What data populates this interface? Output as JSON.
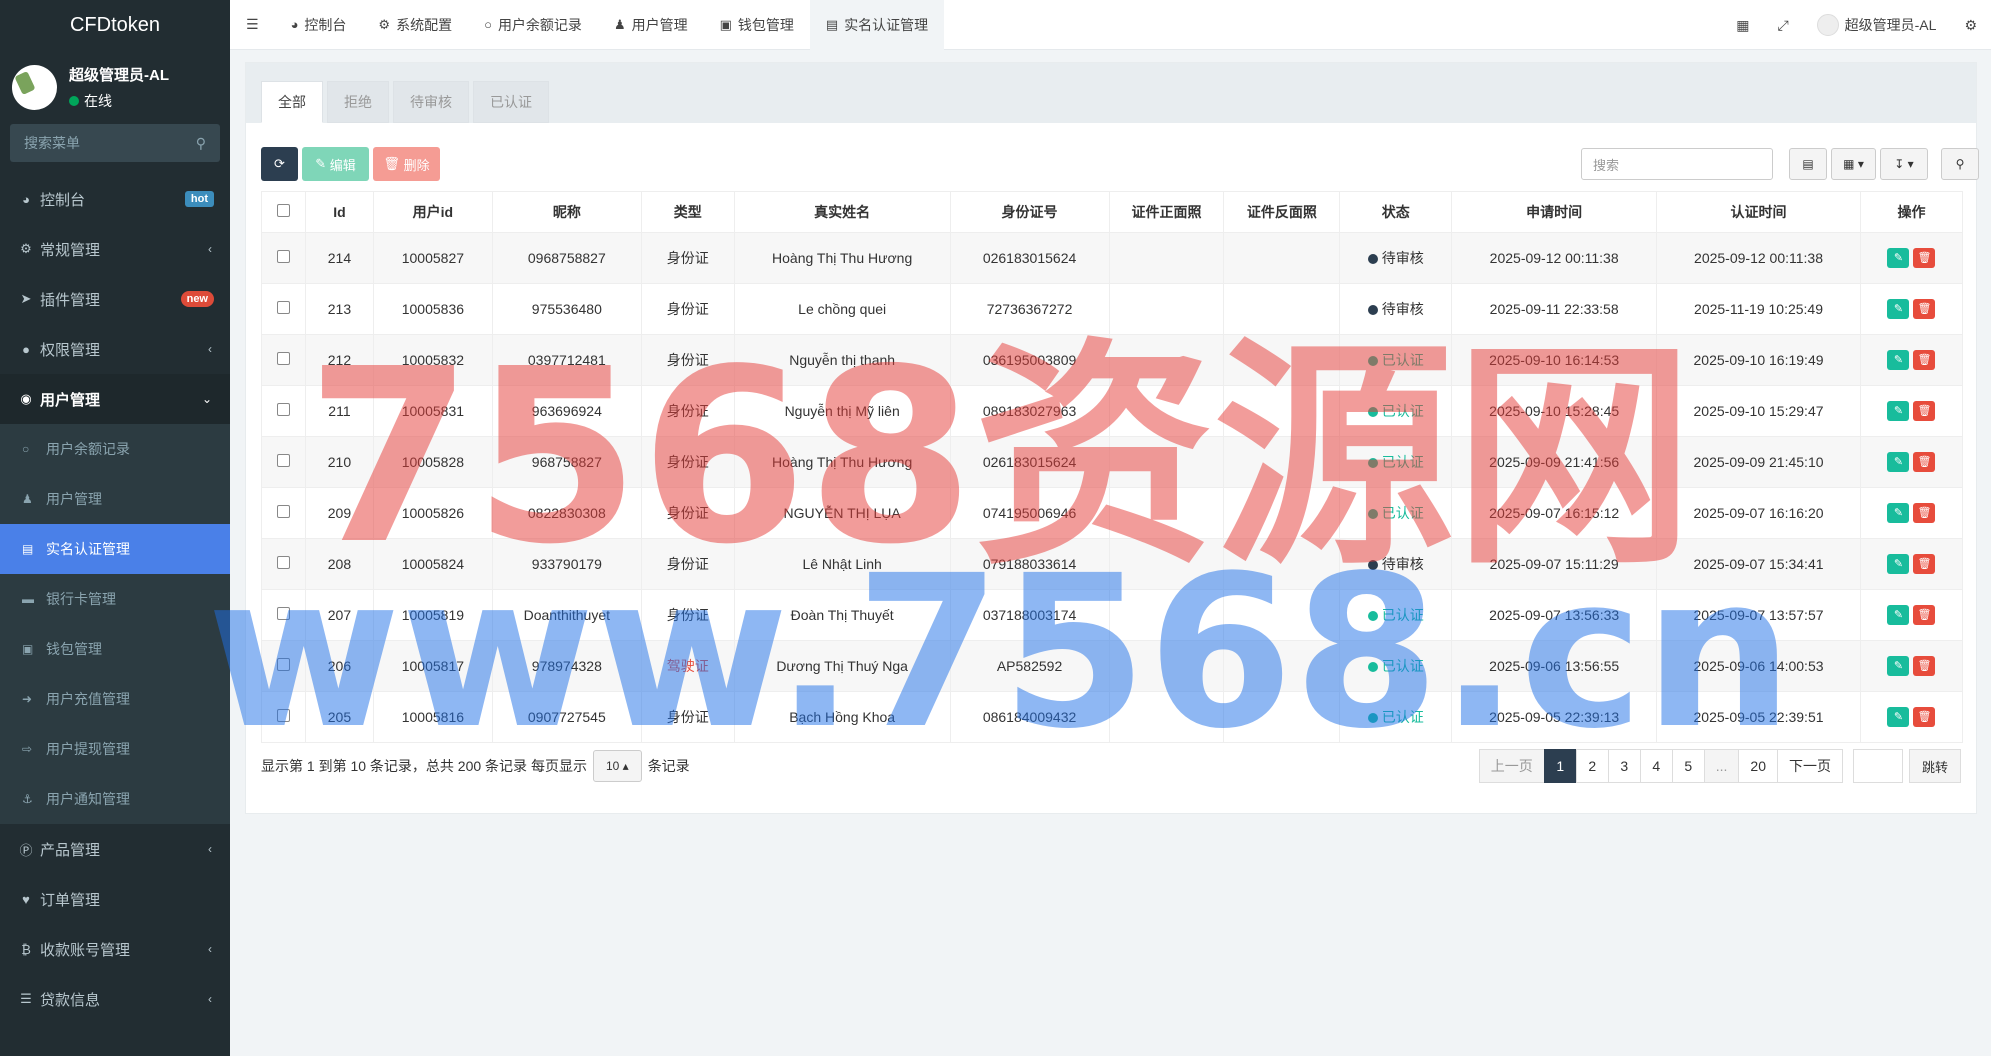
{
  "app": {
    "logo": "CFDtoken"
  },
  "user": {
    "name": "超级管理员-AL",
    "status": "在线"
  },
  "sidebar": {
    "search_placeholder": "搜索菜单",
    "items": [
      {
        "label": "控制台",
        "icon": "dashboard-icon",
        "badge": "hot"
      },
      {
        "label": "常规管理",
        "icon": "cogs-icon"
      },
      {
        "label": "插件管理",
        "icon": "rocket-icon",
        "badge": "new"
      },
      {
        "label": "权限管理",
        "icon": "group-icon"
      },
      {
        "label": "用户管理",
        "icon": "user-circle-icon"
      }
    ],
    "sub_items": [
      {
        "label": "用户余额记录",
        "icon": "circle-icon"
      },
      {
        "label": "用户管理",
        "icon": "user-icon"
      },
      {
        "label": "实名认证管理",
        "icon": "id-card-icon"
      },
      {
        "label": "银行卡管理",
        "icon": "credit-card-icon"
      },
      {
        "label": "钱包管理",
        "icon": "money-icon"
      },
      {
        "label": "用户充值管理",
        "icon": "sign-in-icon"
      },
      {
        "label": "用户提现管理",
        "icon": "sign-out-icon"
      },
      {
        "label": "用户通知管理",
        "icon": "anchor-icon"
      }
    ],
    "bottom_items": [
      {
        "label": "产品管理",
        "icon": "product-icon"
      },
      {
        "label": "订单管理",
        "icon": "heartbeat-icon"
      },
      {
        "label": "收款账号管理",
        "icon": "bitcoin-icon"
      },
      {
        "label": "贷款信息",
        "icon": "list-icon"
      }
    ]
  },
  "topbar": {
    "tabs": [
      {
        "label": "控制台",
        "icon": "dashboard-icon"
      },
      {
        "label": "系统配置",
        "icon": "cog-icon"
      },
      {
        "label": "用户余额记录",
        "icon": "circle-icon"
      },
      {
        "label": "用户管理",
        "icon": "user-icon"
      },
      {
        "label": "钱包管理",
        "icon": "money-icon"
      },
      {
        "label": "实名认证管理",
        "icon": "id-card-icon"
      }
    ],
    "admin_name": "超级管理员-AL"
  },
  "filter_tabs": [
    "全部",
    "拒绝",
    "待审核",
    "已认证"
  ],
  "toolbar": {
    "edit": "编辑",
    "delete": "删除",
    "search_placeholder": "搜索"
  },
  "table": {
    "columns": [
      "Id",
      "用户id",
      "昵称",
      "类型",
      "真实姓名",
      "身份证号",
      "证件正面照",
      "证件反面照",
      "状态",
      "申请时间",
      "认证时间",
      "操作"
    ],
    "rows": [
      {
        "id": "214",
        "uid": "10005827",
        "nick": "0968758827",
        "type": "身份证",
        "name": "Hoàng Thị Thu Hương",
        "idno": "026183015624",
        "status": "待审核",
        "apply": "2025-09-12 00:11:38",
        "verify": "2025-09-12 00:11:38"
      },
      {
        "id": "213",
        "uid": "10005836",
        "nick": "975536480",
        "type": "身份证",
        "name": "Le chồng quei",
        "idno": "72736367272",
        "status": "待审核",
        "apply": "2025-09-11 22:33:58",
        "verify": "2025-11-19 10:25:49"
      },
      {
        "id": "212",
        "uid": "10005832",
        "nick": "0397712481",
        "type": "身份证",
        "name": "Nguyễn thị thanh",
        "idno": "036195003809",
        "status": "已认证",
        "apply": "2025-09-10 16:14:53",
        "verify": "2025-09-10 16:19:49"
      },
      {
        "id": "211",
        "uid": "10005831",
        "nick": "963696924",
        "type": "身份证",
        "name": "Nguyễn thị Mỹ liên",
        "idno": "089183027963",
        "status": "已认证",
        "apply": "2025-09-10 15:28:45",
        "verify": "2025-09-10 15:29:47"
      },
      {
        "id": "210",
        "uid": "10005828",
        "nick": "968758827",
        "type": "身份证",
        "name": "Hoàng Thị Thu Hương",
        "idno": "026183015624",
        "status": "已认证",
        "apply": "2025-09-09 21:41:56",
        "verify": "2025-09-09 21:45:10"
      },
      {
        "id": "209",
        "uid": "10005826",
        "nick": "0822830308",
        "type": "身份证",
        "name": "NGUYỄN THỊ LỤA",
        "idno": "074195006946",
        "status": "已认证",
        "apply": "2025-09-07 16:15:12",
        "verify": "2025-09-07 16:16:20"
      },
      {
        "id": "208",
        "uid": "10005824",
        "nick": "933790179",
        "type": "身份证",
        "name": "Lê Nhật Linh",
        "idno": "079188033614",
        "status": "待审核",
        "apply": "2025-09-07 15:11:29",
        "verify": "2025-09-07 15:34:41"
      },
      {
        "id": "207",
        "uid": "10005819",
        "nick": "Doanthithuyet",
        "type": "身份证",
        "name": "Đoàn Thị Thuyết",
        "idno": "037188003174",
        "status": "已认证",
        "apply": "2025-09-07 13:56:33",
        "verify": "2025-09-07 13:57:57"
      },
      {
        "id": "206",
        "uid": "10005817",
        "nick": "978974328",
        "type": "驾驶证",
        "name": "Dương Thị Thuý Nga",
        "idno": "AP582592",
        "status": "已认证",
        "apply": "2025-09-06 13:56:55",
        "verify": "2025-09-06 14:00:53"
      },
      {
        "id": "205",
        "uid": "10005816",
        "nick": "0907727545",
        "type": "身份证",
        "name": "Bạch Hồng Khoa",
        "idno": "086184009432",
        "status": "已认证",
        "apply": "2025-09-05 22:39:13",
        "verify": "2025-09-05 22:39:51"
      }
    ]
  },
  "footer": {
    "info_prefix": "显示第 1 到第 10 条记录，总共 200 条记录 每页显示",
    "page_size": "10",
    "info_suffix": "条记录",
    "prev": "上一页",
    "pages": [
      "1",
      "2",
      "3",
      "4",
      "5",
      "...",
      "20"
    ],
    "next": "下一页",
    "jump": "跳转"
  },
  "watermark": {
    "line1": "7568资源网",
    "line2": "www.7568.cn"
  },
  "colors": {
    "accent": "#4a80e8",
    "sidebar": "#222d32",
    "success": "#18bc9c",
    "danger": "#e74c3c",
    "primary_dark": "#2c3e50"
  }
}
